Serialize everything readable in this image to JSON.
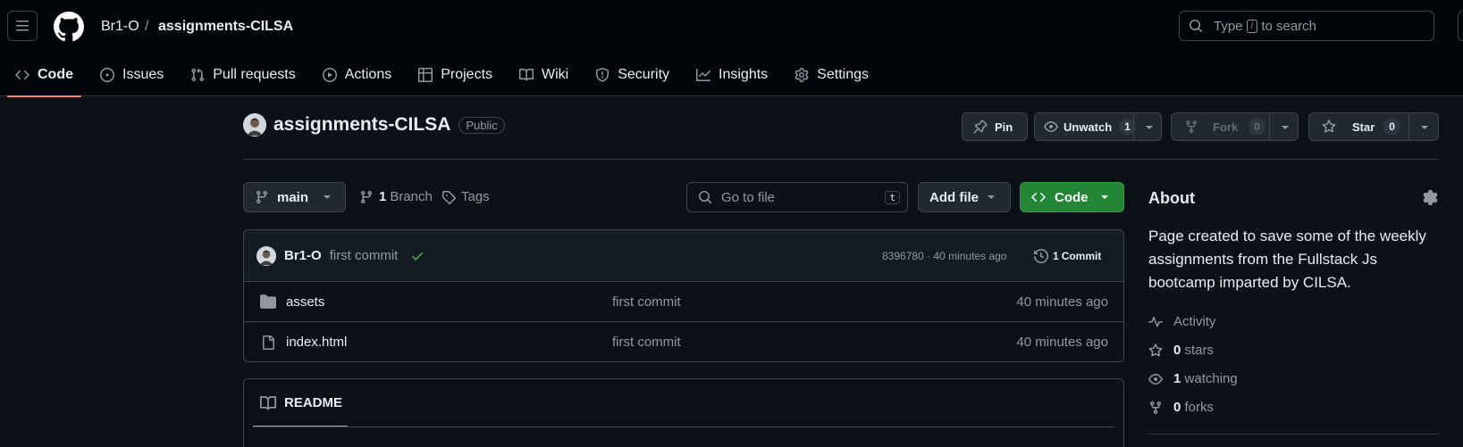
{
  "header": {
    "owner": "Br1-O",
    "separator": "/",
    "repo": "assignments-CILSA",
    "search_pre": "Type",
    "search_key": "/",
    "search_post": "to search"
  },
  "tabs": [
    {
      "label": "Code",
      "icon": "code-icon",
      "active": true
    },
    {
      "label": "Issues",
      "icon": "issue-icon"
    },
    {
      "label": "Pull requests",
      "icon": "pull-request-icon"
    },
    {
      "label": "Actions",
      "icon": "play-icon"
    },
    {
      "label": "Projects",
      "icon": "table-icon"
    },
    {
      "label": "Wiki",
      "icon": "book-icon"
    },
    {
      "label": "Security",
      "icon": "shield-icon"
    },
    {
      "label": "Insights",
      "icon": "graph-icon"
    },
    {
      "label": "Settings",
      "icon": "gear-icon"
    }
  ],
  "repo": {
    "name": "assignments-CILSA",
    "visibility": "Public",
    "pin_label": "Pin",
    "unwatch_label": "Unwatch",
    "watch_count": "1",
    "fork_label": "Fork",
    "fork_count": "0",
    "star_label": "Star",
    "star_count": "0"
  },
  "toolbar": {
    "branch": "main",
    "branch_count": "1",
    "branch_label": "Branch",
    "tags_label": "Tags",
    "goto_placeholder": "Go to file",
    "goto_key": "t",
    "add_file_label": "Add file",
    "code_label": "Code"
  },
  "commit": {
    "author": "Br1-O",
    "message": "first commit",
    "hash_time": "8396780 · 40 minutes ago",
    "commits_count": "1",
    "commits_label": "Commit"
  },
  "files": [
    {
      "name": "assets",
      "type": "folder",
      "message": "first commit",
      "time": "40 minutes ago"
    },
    {
      "name": "index.html",
      "type": "file",
      "message": "first commit",
      "time": "40 minutes ago"
    }
  ],
  "readme": {
    "label": "README"
  },
  "about": {
    "title": "About",
    "description": "Page created to save some of the weekly assignments from the Fullstack Js bootcamp imparted by CILSA.",
    "activity_label": "Activity",
    "stars_count": "0",
    "stars_label": "stars",
    "watching_count": "1",
    "watching_label": "watching",
    "forks_count": "0",
    "forks_label": "forks"
  },
  "colors": {
    "background": "#0d1117",
    "header": "#010409",
    "accent_underline": "#f78166",
    "code_button": "#238636",
    "check": "#3fb950"
  }
}
